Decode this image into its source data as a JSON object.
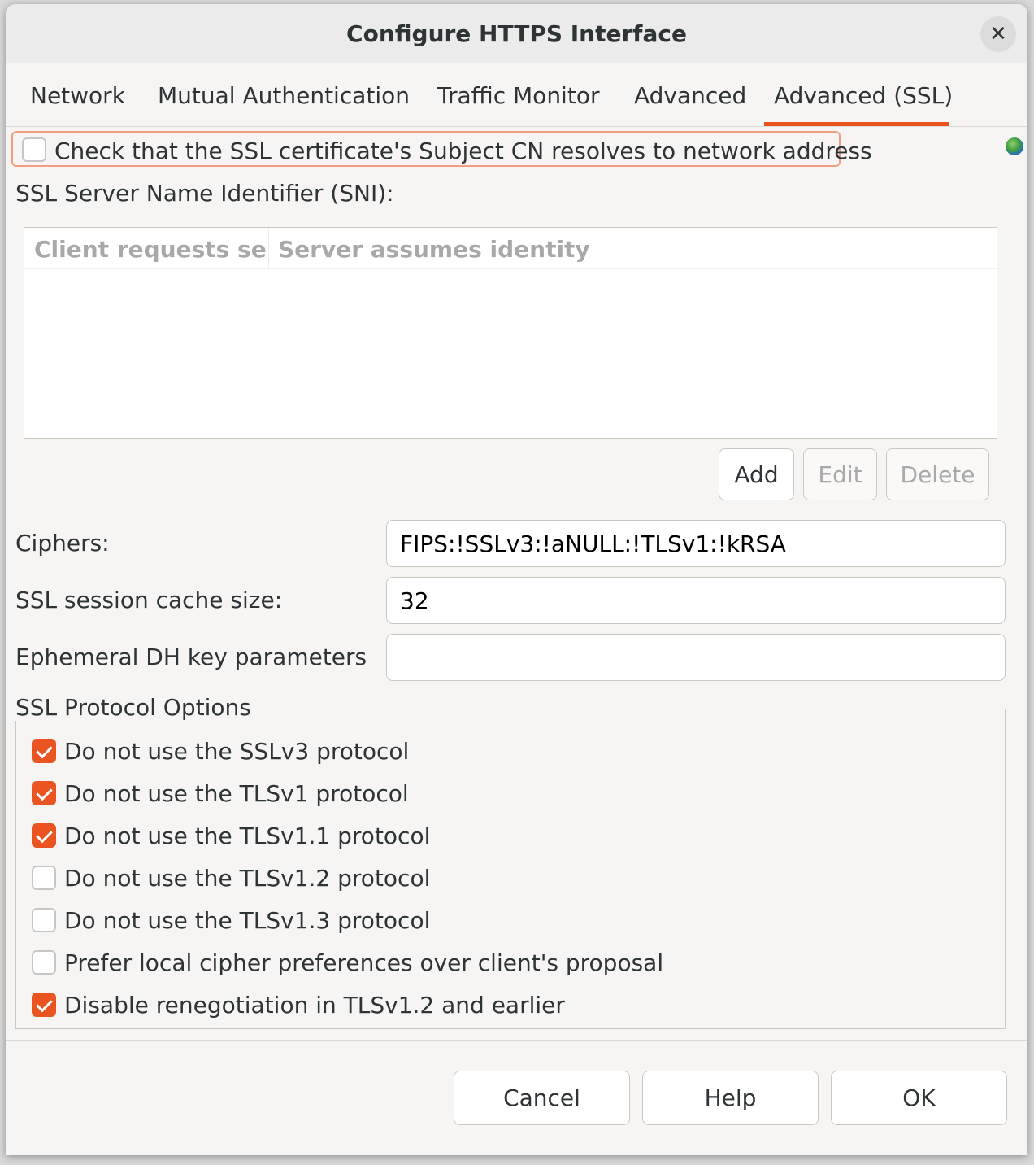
{
  "dialog": {
    "title": "Configure HTTPS Interface",
    "close_symbol": "✕"
  },
  "tabs": [
    {
      "label": "Network"
    },
    {
      "label": "Mutual Authentication"
    },
    {
      "label": "Traffic Monitor"
    },
    {
      "label": "Advanced"
    },
    {
      "label": "Advanced (SSL)",
      "active": true
    }
  ],
  "cn_check": {
    "label": "Check that the SSL certificate's Subject CN resolves to network address",
    "checked": false
  },
  "sni": {
    "label": "SSL Server Name Identifier (SNI):",
    "columns": [
      "Client requests serv",
      "Server assumes identity"
    ],
    "rows": [],
    "buttons": {
      "add": "Add",
      "edit": "Edit",
      "delete": "Delete"
    }
  },
  "fields": {
    "ciphers": {
      "label": "Ciphers:",
      "value": "FIPS:!SSLv3:!aNULL:!TLSv1:!kRSA"
    },
    "cache_size": {
      "label": "SSL session cache size:",
      "value": "32"
    },
    "dh_params": {
      "label": "Ephemeral DH key parameters",
      "value": ""
    }
  },
  "protocol_options": {
    "legend": "SSL Protocol Options",
    "items": [
      {
        "label": "Do not use the SSLv3 protocol",
        "checked": true
      },
      {
        "label": "Do not use the TLSv1 protocol",
        "checked": true
      },
      {
        "label": "Do not use the TLSv1.1 protocol",
        "checked": true
      },
      {
        "label": "Do not use the TLSv1.2 protocol",
        "checked": false
      },
      {
        "label": "Do not use the TLSv1.3 protocol",
        "checked": false
      },
      {
        "label": "Prefer local cipher preferences over client's proposal",
        "checked": false
      },
      {
        "label": "Disable renegotiation in TLSv1.2 and earlier",
        "checked": true
      }
    ]
  },
  "footer": {
    "cancel": "Cancel",
    "help": "Help",
    "ok": "OK"
  },
  "colors": {
    "accent": "#e95420",
    "dialog_bg": "#f6f5f4",
    "text": "#2e3436"
  },
  "icons": {
    "close": "close-icon",
    "globe": "globe-icon",
    "check": "checkmark-icon"
  }
}
